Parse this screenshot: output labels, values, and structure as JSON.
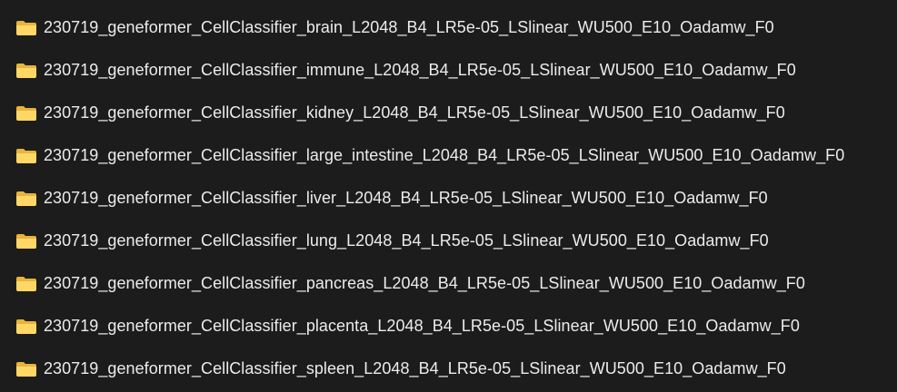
{
  "folder_icon": "folder-icon",
  "colors": {
    "background": "#1c1c1c",
    "text": "#ececec",
    "folder_front": "#ffd766",
    "folder_back": "#e8b43a"
  },
  "folders": [
    {
      "name": "230719_geneformer_CellClassifier_brain_L2048_B4_LR5e-05_LSlinear_WU500_E10_Oadamw_F0"
    },
    {
      "name": "230719_geneformer_CellClassifier_immune_L2048_B4_LR5e-05_LSlinear_WU500_E10_Oadamw_F0"
    },
    {
      "name": "230719_geneformer_CellClassifier_kidney_L2048_B4_LR5e-05_LSlinear_WU500_E10_Oadamw_F0"
    },
    {
      "name": "230719_geneformer_CellClassifier_large_intestine_L2048_B4_LR5e-05_LSlinear_WU500_E10_Oadamw_F0"
    },
    {
      "name": "230719_geneformer_CellClassifier_liver_L2048_B4_LR5e-05_LSlinear_WU500_E10_Oadamw_F0"
    },
    {
      "name": "230719_geneformer_CellClassifier_lung_L2048_B4_LR5e-05_LSlinear_WU500_E10_Oadamw_F0"
    },
    {
      "name": "230719_geneformer_CellClassifier_pancreas_L2048_B4_LR5e-05_LSlinear_WU500_E10_Oadamw_F0"
    },
    {
      "name": "230719_geneformer_CellClassifier_placenta_L2048_B4_LR5e-05_LSlinear_WU500_E10_Oadamw_F0"
    },
    {
      "name": "230719_geneformer_CellClassifier_spleen_L2048_B4_LR5e-05_LSlinear_WU500_E10_Oadamw_F0"
    }
  ]
}
